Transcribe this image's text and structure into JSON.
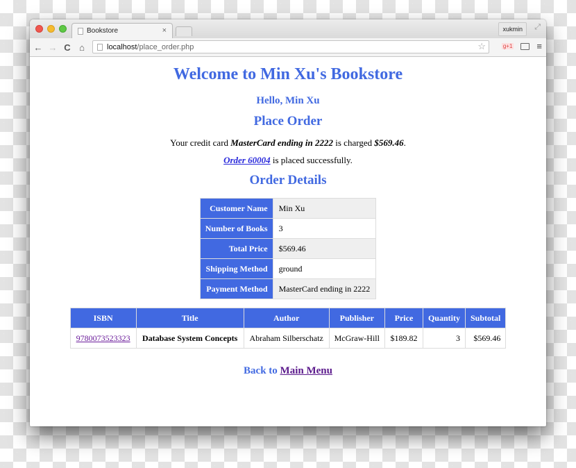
{
  "browser": {
    "tab_title": "Bookstore",
    "tab_close": "×",
    "profile_name": "xukmin",
    "url_host": "localhost",
    "url_path": "/place_order.php",
    "icons": {
      "back": "←",
      "forward": "→",
      "reload": "C",
      "home": "⌂",
      "star": "☆",
      "gplus": "g+1",
      "menu": "≡",
      "fullscreen": "⤢"
    }
  },
  "page": {
    "title": "Welcome to Min Xu's Bookstore",
    "greeting": "Hello, Min Xu",
    "section_title": "Place Order",
    "charge_message": {
      "prefix": "Your credit card ",
      "card": "MasterCard ending in 2222",
      "middle": " is charged ",
      "amount": "$569.46",
      "suffix": "."
    },
    "order_message": {
      "link_text": "Order 60004",
      "suffix": " is placed successfully."
    },
    "details_title": "Order Details",
    "details": [
      {
        "label": "Customer Name",
        "value": "Min Xu"
      },
      {
        "label": "Number of Books",
        "value": "3"
      },
      {
        "label": "Total Price",
        "value": "$569.46"
      },
      {
        "label": "Shipping Method",
        "value": "ground"
      },
      {
        "label": "Payment Method",
        "value": "MasterCard ending in 2222"
      }
    ],
    "items_table": {
      "headers": [
        "ISBN",
        "Title",
        "Author",
        "Publisher",
        "Price",
        "Quantity",
        "Subtotal"
      ],
      "rows": [
        {
          "isbn": "9780073523323",
          "title": "Database System Concepts",
          "author": "Abraham Silberschatz",
          "publisher": "McGraw-Hill",
          "price": "$189.82",
          "quantity": "3",
          "subtotal": "$569.46"
        }
      ]
    },
    "back": {
      "prefix": "Back to ",
      "link_text": "Main Menu"
    }
  },
  "colors": {
    "accent": "#4169e1",
    "visited_link": "#5b1a8c"
  }
}
